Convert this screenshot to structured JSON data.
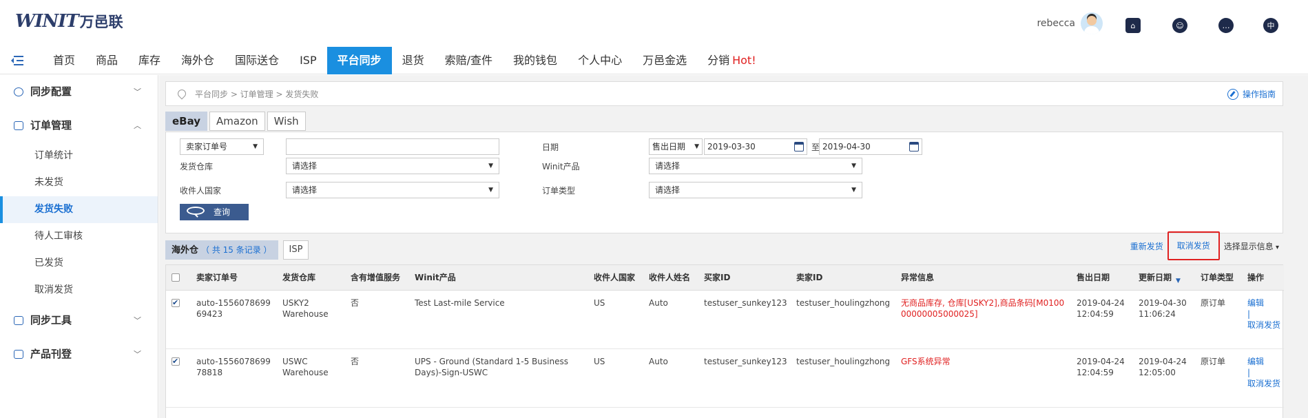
{
  "header": {
    "logo_mark": "WINIT",
    "logo_cn": "万邑联",
    "user_name": "rebecca",
    "icons": [
      "home-upload-icon",
      "support-agent-icon",
      "chat-icon",
      "language-icon"
    ],
    "language_glyph": "中"
  },
  "topnav": {
    "items": [
      "首页",
      "商品",
      "库存",
      "海外仓",
      "国际送仓",
      "ISP",
      "平台同步",
      "退货",
      "索赔/查件",
      "我的钱包",
      "个人中心",
      "万邑金选",
      "分销"
    ],
    "active": "平台同步",
    "hot_label": "Hot!"
  },
  "sidebar": {
    "groups": [
      {
        "label": "同步配置",
        "expanded": false
      },
      {
        "label": "订单管理",
        "expanded": true,
        "items": [
          "订单统计",
          "未发货",
          "发货失败",
          "待人工审核",
          "已发货",
          "取消发货"
        ],
        "active": "发货失败"
      },
      {
        "label": "同步工具",
        "expanded": false
      },
      {
        "label": "产品刊登",
        "expanded": false
      }
    ]
  },
  "breadcrumb": {
    "text": "平台同步 > 订单管理 > 发货失败",
    "guide_label": "操作指南"
  },
  "platform_tabs": {
    "items": [
      "eBay",
      "Amazon",
      "Wish"
    ],
    "active": "eBay"
  },
  "filter": {
    "order_type_select": "卖家订单号",
    "order_input_value": "",
    "date_label": "日期",
    "date_type_select": "售出日期",
    "date_from": "2019-03-30",
    "date_to_label": "至",
    "date_to": "2019-04-30",
    "warehouse_label": "发货仓库",
    "warehouse_select": "请选择",
    "product_label": "Winit产品",
    "product_select": "请选择",
    "country_label": "收件人国家",
    "country_select": "请选择",
    "ordertype_label": "订单类型",
    "ordertype_select": "请选择",
    "query_button": "查询"
  },
  "result_tabs": {
    "overseas_label": "海外仓",
    "overseas_count": "（ 共 15 条记录 ）",
    "isp_label": "ISP"
  },
  "actions": {
    "reship": "重新发货",
    "cancel_ship": "取消发货",
    "display_options": "选择显示信息"
  },
  "table": {
    "columns": [
      "卖家订单号",
      "发货仓库",
      "含有增值服务",
      "Winit产品",
      "收件人国家",
      "收件人姓名",
      "买家ID",
      "卖家ID",
      "异常信息",
      "售出日期",
      "更新日期",
      "订单类型",
      "操作"
    ],
    "rows": [
      {
        "checked": true,
        "order_no": "auto-155607869969423",
        "warehouse": "USKY2 Warehouse",
        "vas": "否",
        "product": "Test Last-mile Service",
        "country": "US",
        "recipient": "Auto",
        "buyer_id": "testuser_sunkey123",
        "seller_id": "testuser_houlingzhong",
        "error": "无商品库存, 仓库[USKY2],商品条码[M010000000005000025]",
        "sold_date": "2019-04-24 12:04:59",
        "updated_date": "2019-04-30 11:06:24",
        "order_type": "原订单",
        "ops": [
          "编辑",
          "|",
          "取消发货"
        ]
      },
      {
        "checked": true,
        "order_no": "auto-155607869978818",
        "warehouse": "USWC Warehouse",
        "vas": "否",
        "product": "UPS - Ground (Standard 1-5 Business Days)-Sign-USWC",
        "country": "US",
        "recipient": "Auto",
        "buyer_id": "testuser_sunkey123",
        "seller_id": "testuser_houlingzhong",
        "error": "GFS系统异常",
        "sold_date": "2019-04-24 12:04:59",
        "updated_date": "2019-04-24 12:05:00",
        "order_type": "原订单",
        "ops": [
          "编辑",
          "|",
          "取消发货"
        ]
      }
    ]
  },
  "colors": {
    "brand_navy": "#2d3e6b",
    "nav_active": "#1a8fe0",
    "link_blue": "#1a6fd1",
    "error_red": "#e02020",
    "highlight_box": "#e02020"
  }
}
